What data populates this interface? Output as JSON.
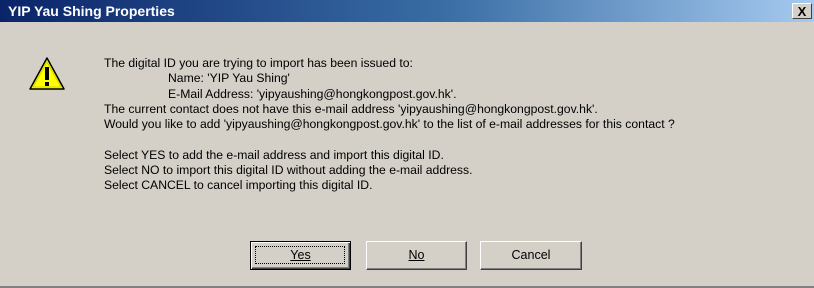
{
  "window": {
    "title": "YIP Yau Shing Properties",
    "close_label": "X"
  },
  "icon": "warning-icon",
  "message": {
    "line1": "The digital ID you are trying to import has been issued to:",
    "name_line": "Name: 'YIP Yau Shing'",
    "email_line": "E-Mail Address: 'yipyaushing@hongkongpost.gov.hk'.",
    "line4": "The current contact does not have this e-mail address 'yipyaushing@hongkongpost.gov.hk'.",
    "line5": "Would you like to add 'yipyaushing@hongkongpost.gov.hk' to the list of e-mail addresses for this contact ?",
    "line6": "Select YES to add the e-mail address and import this digital ID.",
    "line7": "Select NO to import this digital ID without adding the e-mail address.",
    "line8": "Select CANCEL to cancel importing this digital ID."
  },
  "buttons": {
    "yes": "Yes",
    "no": "No",
    "cancel": "Cancel"
  },
  "colors": {
    "titlebar_start": "#0a246a",
    "titlebar_end": "#a6caf0",
    "dialog_face": "#d4d0c8",
    "warning_yellow": "#ffff00"
  }
}
